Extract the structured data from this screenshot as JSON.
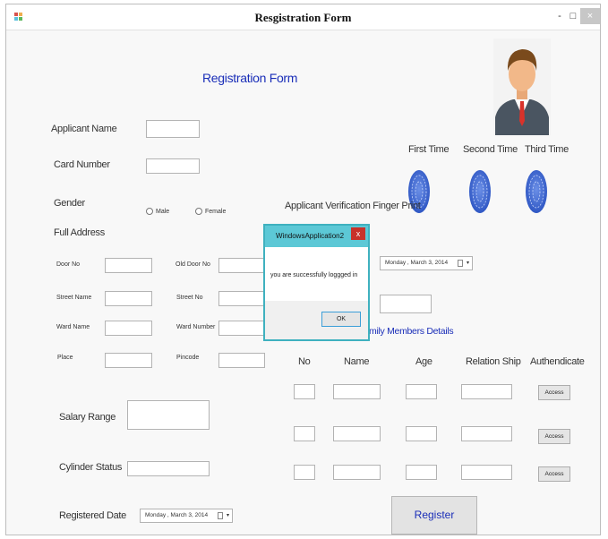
{
  "window": {
    "title": "Resgistration Form",
    "minimize": "-",
    "maximize": "□",
    "close": "×"
  },
  "form": {
    "heading": "Registration Form",
    "applicant_name_label": "Applicant Name",
    "card_number_label": "Card Number",
    "gender_label": "Gender",
    "gender_male": "Male",
    "gender_female": "Female",
    "full_address_label": "Full Address",
    "door_no": "Door No",
    "old_door_no": "Old Door No",
    "street_name": "Street Name",
    "street_no": "Street No",
    "ward_name": "Ward Name",
    "ward_number": "Ward Number",
    "place": "Place",
    "pincode": "Pincode",
    "salary_range_label": "Salary Range",
    "cylinder_status_label": "Cylinder Status",
    "registered_date_label": "Registered Date",
    "registered_date_value": "Monday ,   March    3, 2014",
    "register_button": "Register"
  },
  "fingerprint": {
    "first": "First Time",
    "second": "Second Time",
    "third": "Third Time",
    "verification_label": "Applicant Verification Finger Print",
    "date_value": "Monday ,   March    3, 2014"
  },
  "family": {
    "title": "Family Members Details",
    "title_visible": "mily Members Details",
    "columns": [
      "No",
      "Name",
      "Age",
      "Relation Ship",
      "Authendicate"
    ],
    "access_label": "Access"
  },
  "dialog": {
    "title": "WindowsApplication2",
    "message": "you are successfully loggged in",
    "ok": "OK",
    "close": "x"
  },
  "colors": {
    "heading": "#1a2eb8",
    "dialog_border": "#3fb1bf",
    "fingerprint": "#3f6fd0"
  }
}
